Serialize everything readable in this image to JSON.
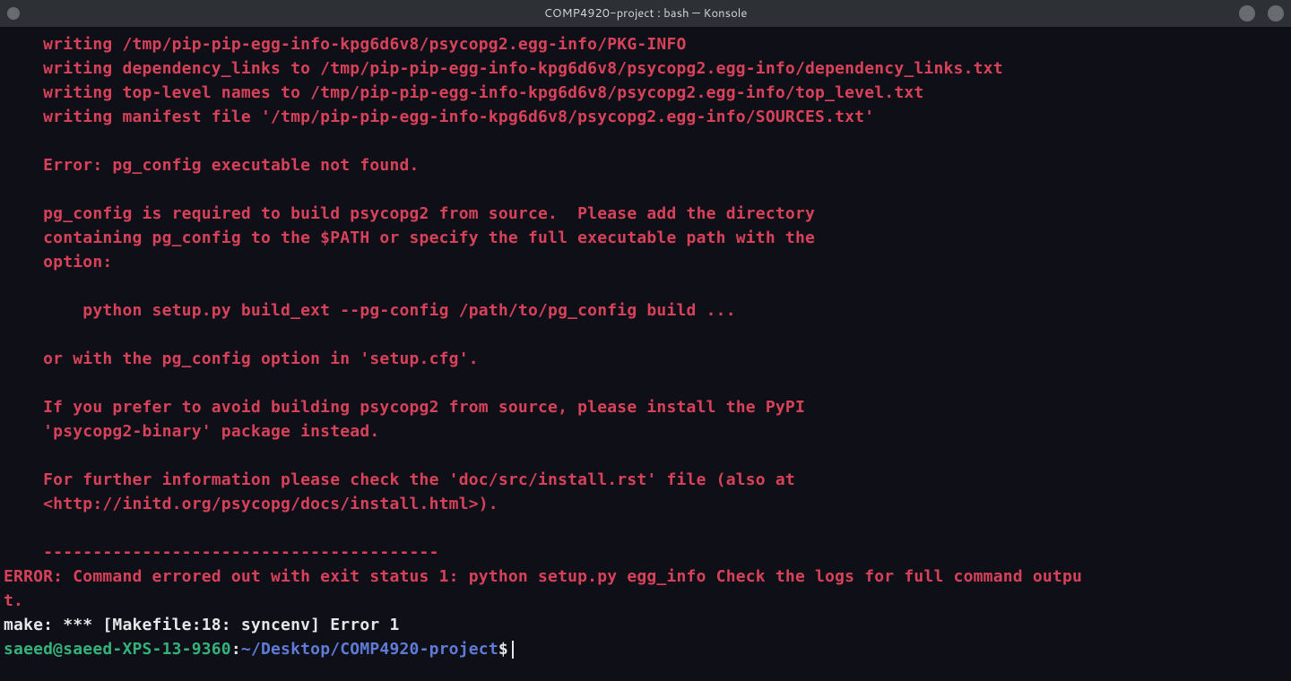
{
  "window": {
    "title": "COMP4920-project : bash — Konsole"
  },
  "terminal": {
    "error_indent": "    writing /tmp/pip-pip-egg-info-kpg6d6v8/psycopg2.egg-info/PKG-INFO\n    writing dependency_links to /tmp/pip-pip-egg-info-kpg6d6v8/psycopg2.egg-info/dependency_links.txt\n    writing top-level names to /tmp/pip-pip-egg-info-kpg6d6v8/psycopg2.egg-info/top_level.txt\n    writing manifest file '/tmp/pip-pip-egg-info-kpg6d6v8/psycopg2.egg-info/SOURCES.txt'\n\n    Error: pg_config executable not found.\n\n    pg_config is required to build psycopg2 from source.  Please add the directory\n    containing pg_config to the $PATH or specify the full executable path with the\n    option:\n\n        python setup.py build_ext --pg-config /path/to/pg_config build ...\n\n    or with the pg_config option in 'setup.cfg'.\n\n    If you prefer to avoid building psycopg2 from source, please install the PyPI\n    'psycopg2-binary' package instead.\n\n    For further information please check the 'doc/src/install.rst' file (also at\n    <http://initd.org/psycopg/docs/install.html>).\n\n    ----------------------------------------",
    "error_summary": "ERROR: Command errored out with exit status 1: python setup.py egg_info Check the logs for full command outpu\nt.",
    "make_line": "make: *** [Makefile:18: syncenv] Error 1",
    "prompt": {
      "user_host": "saeed@saeed-XPS-13-9360",
      "colon": ":",
      "cwd": "~/Desktop/COMP4920-project",
      "sigil": "$"
    }
  }
}
